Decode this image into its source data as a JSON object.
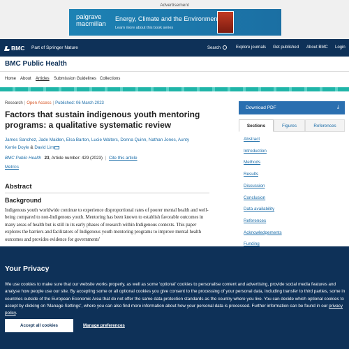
{
  "advert": {
    "label": "Advertisement",
    "logo_line1": "palgrave",
    "logo_line2": "macmillan",
    "title": "Energy, Climate and the Environment",
    "subtitle": "Learn more about this book series"
  },
  "topnav": {
    "logo": "BMC",
    "part_of": "Part of Springer Nature",
    "search": "Search",
    "explore": "Explore journals",
    "get_published": "Get published",
    "about": "About BMC",
    "login": "Login"
  },
  "journal": {
    "title": "BMC Public Health"
  },
  "subnav": [
    "Home",
    "About",
    "Articles",
    "Submission Guidelines",
    "Collections"
  ],
  "article": {
    "type": "Research",
    "access": "Open Access",
    "published": "Published: 06 March 2023",
    "title": "Factors that sustain indigenous youth mentoring programs: a qualitative systematic review",
    "authors_line1": "James Sanchez, Jade Maiden, Elsa Barton, Lucie Walters, Donna Quinn, Nathan Jones, Aunty",
    "authors_line2": "Kerrie Doyle",
    "authors_and": " & ",
    "authors_last": "David Lim",
    "citation_journal": "BMC Public Health",
    "citation_volume": "23",
    "citation_rest": ", Article number: 429 (2023)",
    "cite_link": "Cite this article",
    "metrics": "Metrics"
  },
  "abstract": {
    "heading": "Abstract",
    "section": "Background",
    "text": "Indigenous youth worldwide continue to experience disproportional rates of poorer mental health and well-being compared to non-Indigenous youth. Mentoring has been known to establish favorable outcomes in many areas of health but is still in its early phases of research within Indigenous contexts. This paper explores the barriers and facilitators of Indigenous youth mentoring programs to improve mental health outcomes and provides evidence for governments'"
  },
  "sidebar": {
    "download": "Download PDF",
    "tabs": [
      "Sections",
      "Figures",
      "References"
    ],
    "toc": [
      "Abstract",
      "Introduction",
      "Methods",
      "Results",
      "Discussion",
      "Conclusion",
      "Data availability",
      "References",
      "Acknowledgements",
      "Funding"
    ]
  },
  "cookie": {
    "heading": "Your Privacy",
    "text_main": "We use cookies to make sure that our website works properly, as well as some 'optional' cookies to personalise content and advertising, provide social media features and analyse how people use our site. By accepting some or all optional cookies you give consent to the processing of your personal data, including transfer to third parties, some in countries outside of the European Economic Area that do not offer the same data protection standards as the country where you live. You can decide which optional cookies to accept by clicking on 'Manage Settings', where you can also find more information about how your personal data is processed. Further information can be found in our ",
    "policy_link": "privacy policy",
    "text_end": ".",
    "accept": "Accept all cookies",
    "manage": "Manage preferences"
  },
  "colors": {
    "navy": "#0e3158",
    "link": "#1a6ca8",
    "teal": "#1fb5a8",
    "open_access": "#d65422",
    "download": "#2a6fb0"
  }
}
